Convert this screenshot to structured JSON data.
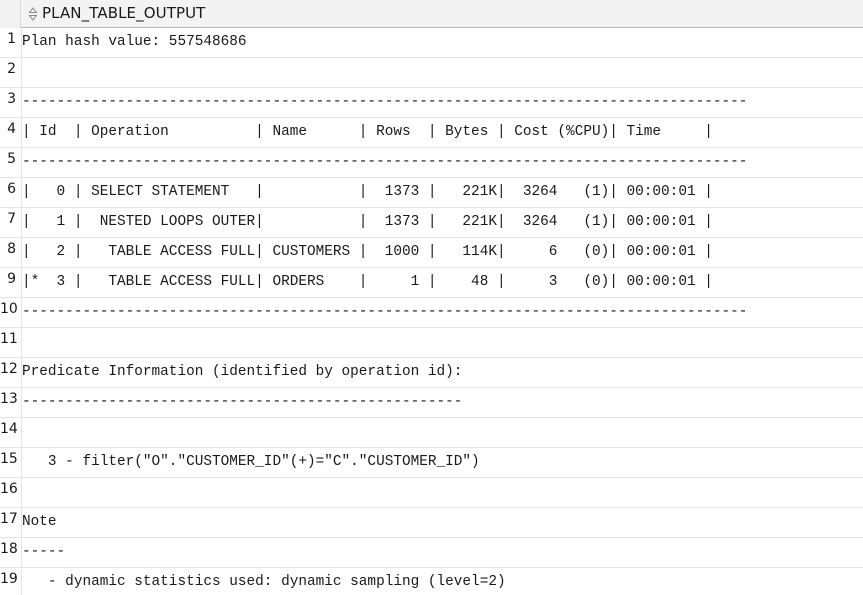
{
  "column": {
    "title": "PLAN_TABLE_OUTPUT",
    "sort_icon": "sort-arrows-icon"
  },
  "rows": [
    {
      "num": "1",
      "text": "Plan hash value: 557548686"
    },
    {
      "num": "2",
      "text": ""
    },
    {
      "num": "3",
      "text": "------------------------------------------------------------------------------------"
    },
    {
      "num": "4",
      "text": "| Id  | Operation          | Name      | Rows  | Bytes | Cost (%CPU)| Time     |"
    },
    {
      "num": "5",
      "text": "------------------------------------------------------------------------------------"
    },
    {
      "num": "6",
      "text": "|   0 | SELECT STATEMENT   |           |  1373 |   221K|  3264   (1)| 00:00:01 |"
    },
    {
      "num": "7",
      "text": "|   1 |  NESTED LOOPS OUTER|           |  1373 |   221K|  3264   (1)| 00:00:01 |"
    },
    {
      "num": "8",
      "text": "|   2 |   TABLE ACCESS FULL| CUSTOMERS |  1000 |   114K|     6   (0)| 00:00:01 |"
    },
    {
      "num": "9",
      "text": "|*  3 |   TABLE ACCESS FULL| ORDERS    |     1 |    48 |     3   (0)| 00:00:01 |"
    },
    {
      "num": "10",
      "text": "------------------------------------------------------------------------------------"
    },
    {
      "num": "11",
      "text": ""
    },
    {
      "num": "12",
      "text": "Predicate Information (identified by operation id):"
    },
    {
      "num": "13",
      "text": "---------------------------------------------------"
    },
    {
      "num": "14",
      "text": ""
    },
    {
      "num": "15",
      "text": "   3 - filter(\"O\".\"CUSTOMER_ID\"(+)=\"C\".\"CUSTOMER_ID\")"
    },
    {
      "num": "16",
      "text": ""
    },
    {
      "num": "17",
      "text": "Note"
    },
    {
      "num": "18",
      "text": "-----"
    },
    {
      "num": "19",
      "text": "   - dynamic statistics used: dynamic sampling (level=2)"
    }
  ]
}
